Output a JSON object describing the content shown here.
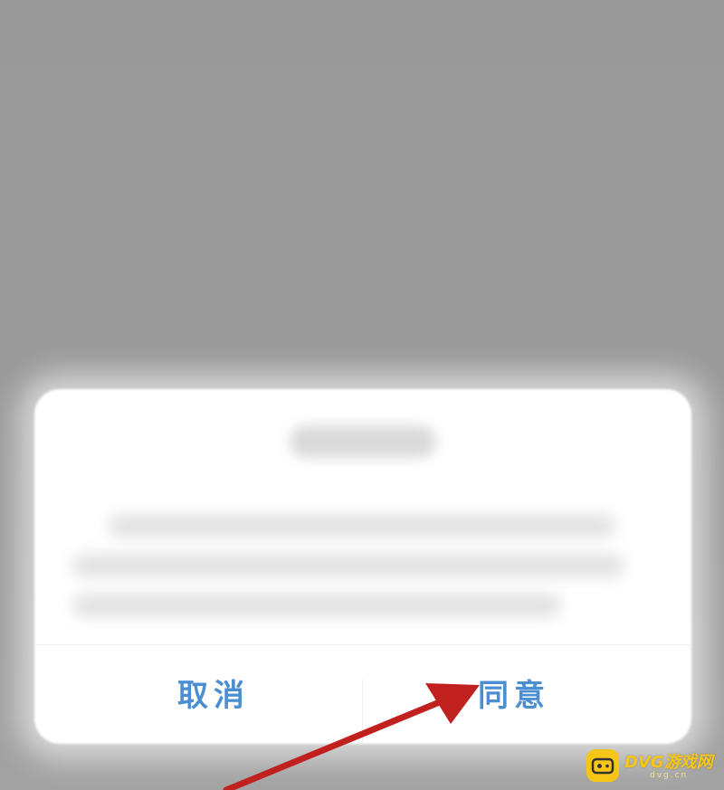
{
  "dialog": {
    "title": "",
    "body_lines": [
      "",
      "",
      ""
    ],
    "buttons": {
      "cancel_label": "取消",
      "agree_label": "同意"
    }
  },
  "annotation": {
    "arrow_color": "#c0211f",
    "target": "agree-button"
  },
  "watermark": {
    "name": "DVG游戏网",
    "sub": "dvg.cn",
    "color": "#f5c518"
  },
  "colors": {
    "button_text": "#4c8fd0",
    "backdrop": "#999999",
    "dialog_bg": "#ffffff"
  }
}
